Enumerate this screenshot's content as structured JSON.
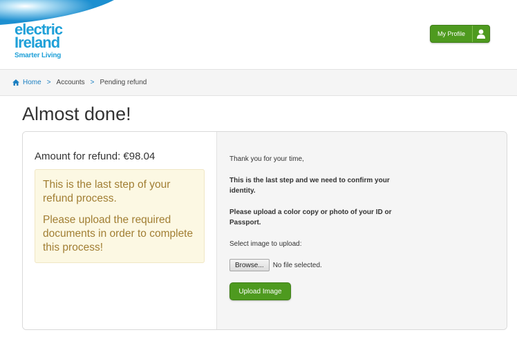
{
  "header": {
    "logo": {
      "line1": "electric",
      "line2": "Ireland",
      "tagline": "Smarter Living"
    },
    "profile_button": {
      "label": "My Profile",
      "icon": "user-icon"
    }
  },
  "breadcrumb": {
    "home_icon": "home-icon",
    "items": [
      "Home",
      "Accounts",
      "Pending refund"
    ],
    "separator": ">"
  },
  "page": {
    "title": "Almost done!"
  },
  "left": {
    "amount": "Amount for refund: €98.04",
    "notice": {
      "p1": "This is the last step of your refund process.",
      "p2": "Please upload the required documents in order to complete this process!"
    }
  },
  "right": {
    "thanks": "Thank you for your time,",
    "confirm": "This is the last step and we need to confirm your identity.",
    "upload_instr": "Please upload a color copy or photo of your ID or Passport.",
    "select_label": "Select image to upload:",
    "browse_label": "Browse...",
    "file_status": "No file selected.",
    "upload_button": "Upload Image"
  },
  "colors": {
    "brand_blue": "#1fa0d8",
    "button_green": "#4e9a1f",
    "notice_bg": "#fcf8e3",
    "notice_text": "#a17e33",
    "link_blue": "#1a7fc1"
  }
}
